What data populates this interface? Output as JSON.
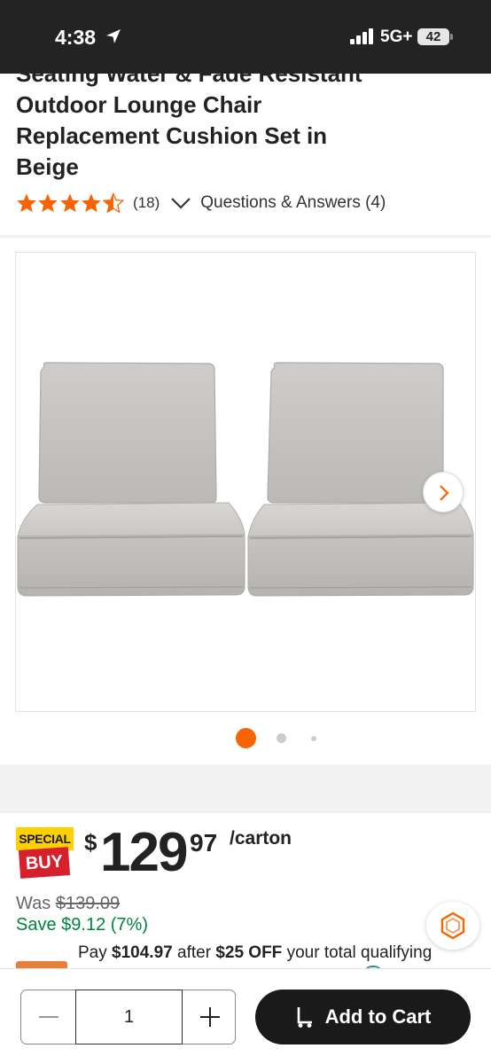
{
  "status_bar": {
    "time": "4:38",
    "network": "5G+",
    "battery": "42"
  },
  "product": {
    "title_lines": [
      "Seating Water & Fade Resistant",
      "Outdoor Lounge Chair",
      "Replacement Cushion Set in",
      "Beige"
    ],
    "rating": 4.5,
    "review_count": "(18)",
    "qa_label": "Questions & Answers (4)"
  },
  "gallery": {
    "image_count": 3,
    "active_index": 0
  },
  "pricing": {
    "badge_top": "SPECIAL",
    "badge_bottom": "BUY",
    "currency": "$",
    "price_whole": "129",
    "price_cents": "97",
    "unit": "/carton",
    "was_label": "Was",
    "was_price": "$139.09",
    "save_text": "Save $9.12 (7%)",
    "pay_prefix": "Pay",
    "pay_amount": "$104.97",
    "pay_middle": "after",
    "pay_discount": "$25 OFF",
    "pay_suffix": "your total qualifying"
  },
  "cart": {
    "quantity": "1",
    "add_label": "Add to Cart"
  },
  "colors": {
    "brand_orange": "#f96302",
    "save_green": "#00843d",
    "badge_yellow": "#fdd000",
    "badge_red": "#d6202b"
  }
}
